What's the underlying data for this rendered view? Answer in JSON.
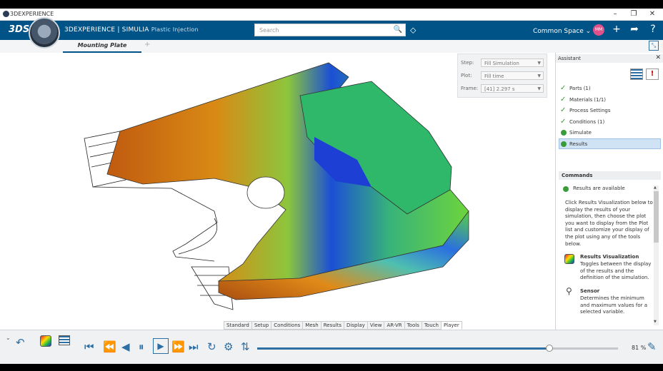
{
  "window": {
    "title": "3DEXPERIENCE",
    "minimize": "–",
    "restore": "❐",
    "close": "✕"
  },
  "topbar": {
    "logo": "3DS",
    "brand": "3DEXPERIENCE | SIMULIA",
    "app_name": "Plastic Injection",
    "search_placeholder": "Search",
    "space": "Common Space ⌄",
    "avatar": "MM"
  },
  "tab": {
    "label": "Mounting Plate",
    "add": "+"
  },
  "controls": {
    "step_label": "Step:",
    "step_value": "Fill Simulation",
    "plot_label": "Plot:",
    "plot_value": "Fill time",
    "frame_label": "Frame:",
    "frame_value": "[41]   2.297 s"
  },
  "assistant": {
    "title": "Assistant",
    "steps": [
      {
        "label": "Parts (1)",
        "state": "done"
      },
      {
        "label": "Materials (1/1)",
        "state": "done"
      },
      {
        "label": "Process Settings",
        "state": "done"
      },
      {
        "label": "Conditions (1)",
        "state": "done"
      },
      {
        "label": "Simulate",
        "state": "ok"
      },
      {
        "label": "Results",
        "state": "ok"
      }
    ],
    "commands_title": "Commands",
    "status": "Results are available",
    "instructions": "Click Results Visualization below to display the results of your simulation, then choose the plot you want to display from the Plot list and customize your display of the plot using any of the tools below.",
    "results_viz_title": "Results Visualization",
    "results_viz_desc": "Toggles between the display of the results and the definition of the simulation.",
    "sensor_title": "Sensor",
    "sensor_desc": "Determines the minimum and maximum values for a selected variable."
  },
  "action_tabs": [
    "Standard",
    "Setup",
    "Conditions",
    "Mesh",
    "Results",
    "Display",
    "View",
    "AR-VR",
    "Tools",
    "Touch",
    "Player"
  ],
  "active_action_tab": "Player",
  "player": {
    "progress": 0.81,
    "percent_label": "81 %"
  },
  "colors": {
    "brand_blue": "#005386",
    "accent": "#2d6ea3",
    "ok_green": "#3a9b3a"
  }
}
